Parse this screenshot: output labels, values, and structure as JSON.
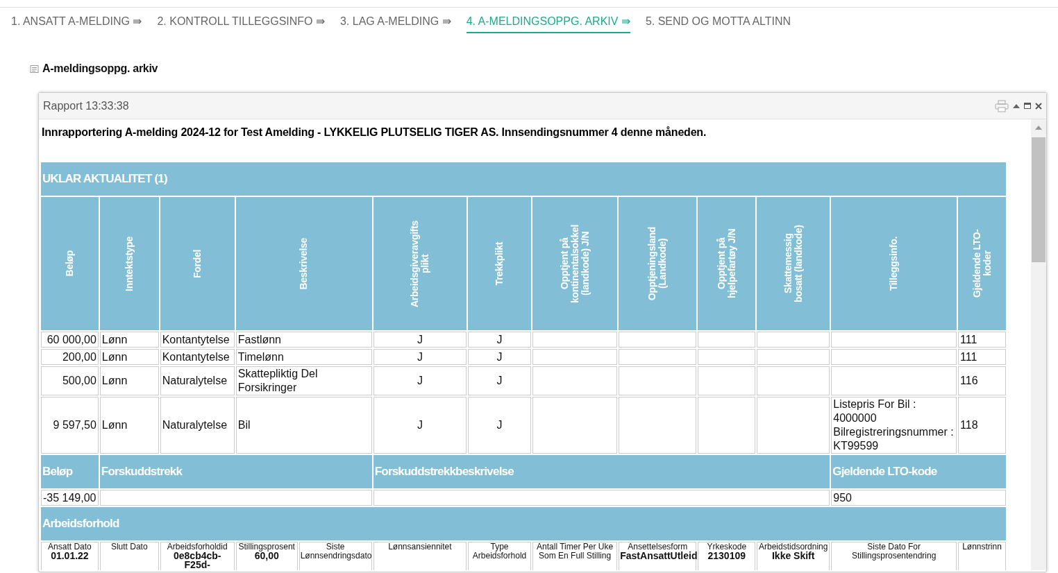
{
  "tabs": [
    {
      "label": "1. ANSATT A-MELDING ⇛",
      "selected": false
    },
    {
      "label": "2. KONTROLL TILLEGGSINFO ⇛",
      "selected": false
    },
    {
      "label": "3. LAG A-MELDING ⇛",
      "selected": false
    },
    {
      "label": "4. A-MELDINGSOPPG. ARKIV ⇛",
      "selected": true
    },
    {
      "label": "5. SEND OG MOTTA ALTINN",
      "selected": false
    }
  ],
  "section_title": "A-meldingsoppg. arkiv",
  "dialog": {
    "title": "Rapport 13:33:38",
    "heading": "Innrapportering A-melding 2024-12 for Test Amelding - LYKKELIG PLUTSELIG TIGER AS. Innsendingsnummer 4 denne måneden.",
    "income": {
      "title": "UKLAR AKTUALITET (1)",
      "columns": [
        "Beløp",
        "Inntektstype",
        "Fordel",
        "Beskrivelse",
        "Arbeidsgiveravgifts plikt",
        "Trekkplikt",
        "Opptjent på kontinentalsokkel (landkode) J/N",
        "Opptjeningsland (Landkode)",
        "Opptjent på hjelpefartøy J/N",
        "Skattemessig bosatt (landkode)",
        "Tilleggsinfo.",
        "Gjeldende LTO-koder"
      ],
      "rows": [
        [
          "60 000,00",
          "Lønn",
          "Kontantytelse",
          "Fastlønn",
          "J",
          "J",
          "",
          "",
          "",
          "",
          "",
          "111"
        ],
        [
          "200,00",
          "Lønn",
          "Kontantytelse",
          "Timelønn",
          "J",
          "J",
          "",
          "",
          "",
          "",
          "",
          "111"
        ],
        [
          "500,00",
          "Lønn",
          "Naturalytelse",
          "Skattepliktig Del Forsikringer",
          "J",
          "J",
          "",
          "",
          "",
          "",
          "",
          "116"
        ],
        [
          "9 597,50",
          "Lønn",
          "Naturalytelse",
          "Bil",
          "J",
          "J",
          "",
          "",
          "",
          "",
          "Listepris For Bil : 4000000 Bilregistreringsnummer : KT99599",
          "118"
        ]
      ]
    },
    "withholding": {
      "columns": [
        "Beløp",
        "Forskuddstrekk",
        "Forskuddstrekkbeskrivelse",
        "Gjeldende LTO-kode"
      ],
      "rows": [
        [
          "-35 149,00",
          "",
          "",
          "950"
        ]
      ]
    },
    "employment": {
      "title": "Arbeidsforhold",
      "fields": [
        {
          "label": "Ansatt Dato",
          "value": "01.01.22"
        },
        {
          "label": "Slutt Dato"
        },
        {
          "label": "Arbeidsforholdid",
          "value": "0e8cb4cb-F25d-"
        },
        {
          "label": "Stillingsprosent",
          "value": "60,00"
        },
        {
          "label": "Siste Lønnsendringsdato"
        },
        {
          "label": "Lønnsansiennitet"
        },
        {
          "label": "Type Arbeidsforhold"
        },
        {
          "label": "Antall Timer Per Uke Som En Full Stilling"
        },
        {
          "label": "Ansettelsesform",
          "value": "FastAnsattUtleid"
        },
        {
          "label": "Yrkeskode",
          "value": "2130109"
        },
        {
          "label": "Arbeidstidsordning",
          "value": "Ikke Skift"
        },
        {
          "label": "Siste Dato For Stillingsprosentendring"
        },
        {
          "label": "Lønnstrinn"
        }
      ]
    }
  }
}
